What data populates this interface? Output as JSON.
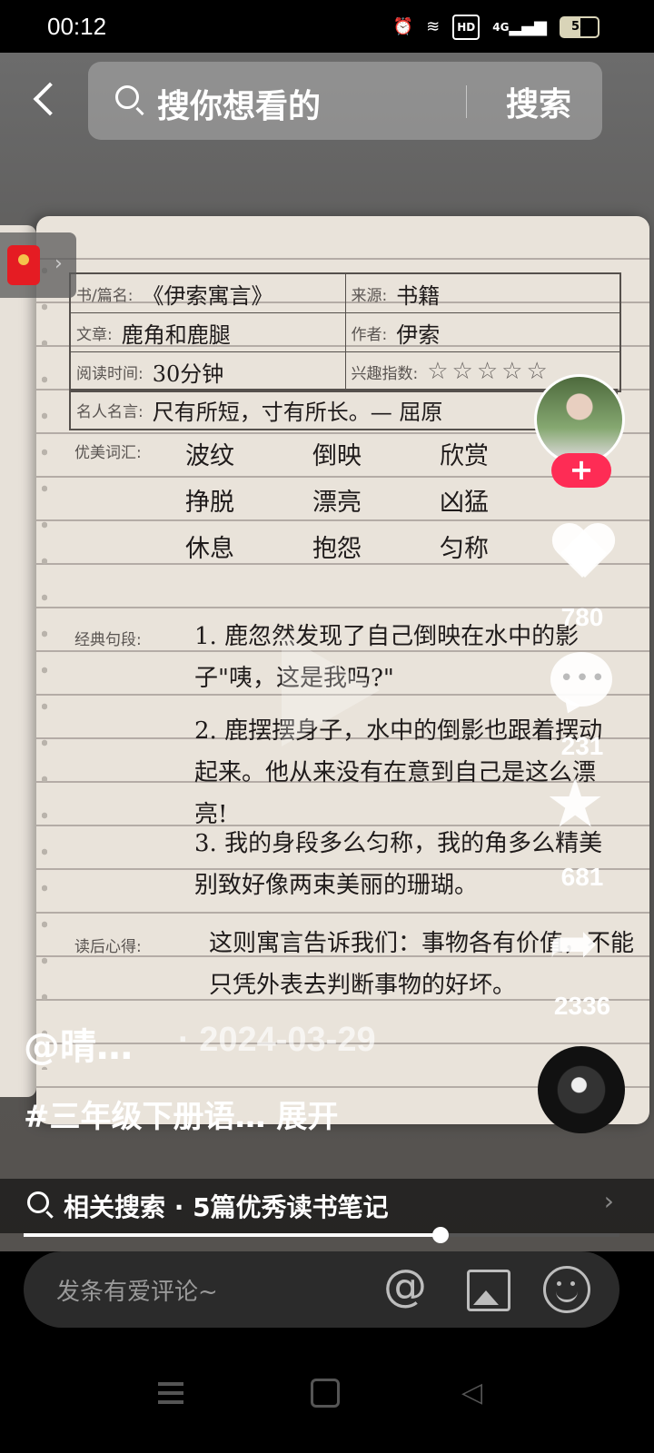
{
  "status_bar": {
    "time": "00:12",
    "network": "4G",
    "hd": "HD",
    "battery": "53",
    "battery_level": 0.53,
    "icons": [
      "alarm-icon",
      "wifi-icon",
      "hd-icon",
      "signal-icon",
      "battery-icon"
    ]
  },
  "search": {
    "placeholder": "搜你想看的",
    "button": "搜索"
  },
  "notebook": {
    "book_label": "书/篇名:",
    "book_value": "《伊索寓言》",
    "source_label": "来源:",
    "source_value": "书籍",
    "article_label": "文章:",
    "article_value": "鹿角和鹿腿",
    "author_label": "作者:",
    "author_value": "伊索",
    "time_label": "阅读时间:",
    "time_value": "30分钟",
    "interest_label": "兴趣指数:",
    "interest_stars": "☆☆☆☆☆",
    "quote_label": "名人名言:",
    "quote_value": "尺有所短，寸有所长。— 屈原",
    "vocab_label": "优美词汇:",
    "vocab": [
      "波纹",
      "倒映",
      "欣赏",
      "挣脱",
      "漂亮",
      "凶猛",
      "休息",
      "抱怨",
      "匀称"
    ],
    "classic_label": "经典句段:",
    "sentences": [
      "1. 鹿忽然发现了自己倒映在水中的影子\"咦，这是我吗?\"",
      "2. 鹿摆摆身子，水中的倒影也跟着摆动起来。他从来没有在意到自己是这么漂亮!",
      "3. 我的身段多么匀称，我的角多么精美别致好像两束美丽的珊瑚。"
    ],
    "reflection_label": "读后心得:",
    "reflection": "这则寓言告诉我们：事物各有价值，不能只凭外表去判断事物的好坏。"
  },
  "rail": {
    "likes": "780",
    "comments": "231",
    "favorites": "681",
    "shares": "2336",
    "follow": "+"
  },
  "post": {
    "author": "@晴…",
    "date": "· 2024-03-29",
    "caption": "#三年级下册语… ",
    "expand": "展开"
  },
  "related": {
    "text": "相关搜索 · 5篇优秀读书笔记"
  },
  "progress": {
    "fraction": 0.7
  },
  "comment_bar": {
    "placeholder": "发条有爱评论~"
  }
}
